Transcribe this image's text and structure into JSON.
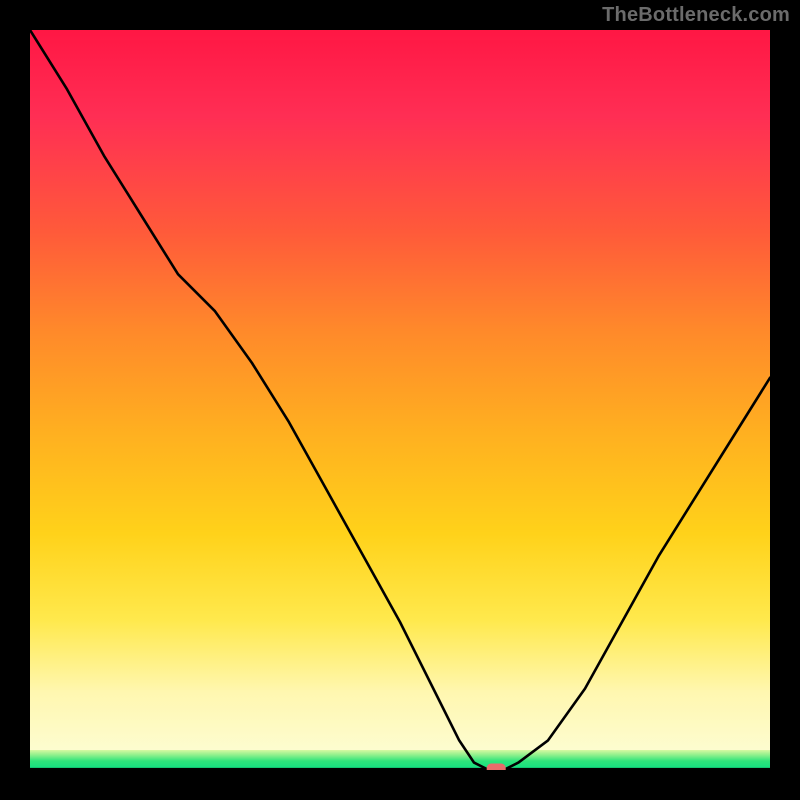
{
  "watermark": "TheBottleneck.com",
  "chart_data": {
    "type": "line",
    "title": "",
    "xlabel": "",
    "ylabel": "",
    "xlim": [
      0,
      100
    ],
    "ylim": [
      0,
      100
    ],
    "x": [
      0,
      5,
      10,
      15,
      20,
      25,
      30,
      35,
      40,
      45,
      50,
      55,
      58,
      60,
      62,
      64,
      66,
      70,
      75,
      80,
      85,
      90,
      95,
      100
    ],
    "y": [
      100,
      92,
      83,
      75,
      67,
      62,
      55,
      47,
      38,
      29,
      20,
      10,
      4,
      1,
      0,
      0,
      1,
      4,
      11,
      20,
      29,
      37,
      45,
      53
    ],
    "marker": {
      "x": 63,
      "y": 0
    },
    "green_band_range_pct": [
      97.3,
      100
    ],
    "notes": "Y expressed as percent of plot height from bottom; curve is a V-shaped profile bottoming out near x≈63."
  }
}
